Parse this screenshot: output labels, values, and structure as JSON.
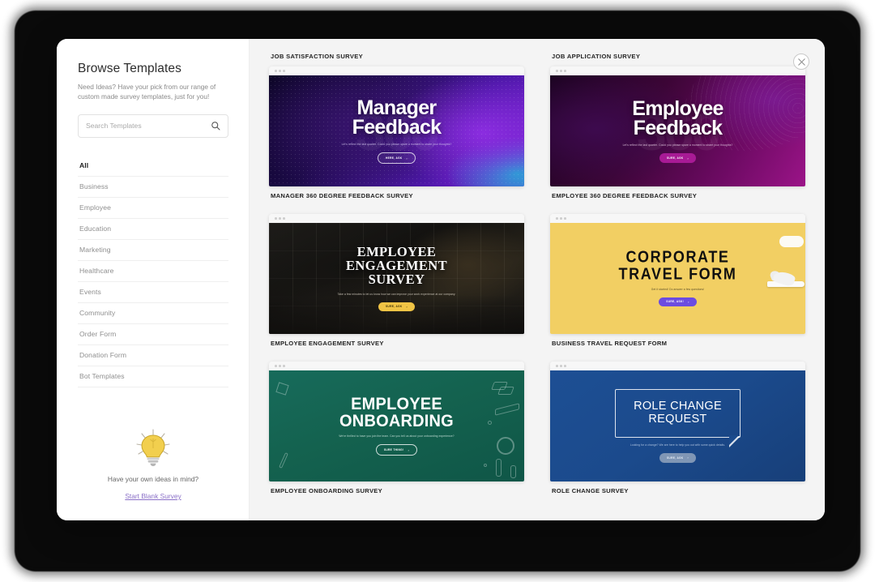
{
  "modal": {
    "close_label": "×",
    "close_icon": "close-circle-icon"
  },
  "sidebar": {
    "title": "Browse Templates",
    "subtitle": "Need Ideas? Have your pick from our range of custom made survey templates, just for you!",
    "search": {
      "placeholder": "Search Templates",
      "value": "",
      "icon": "search-icon"
    },
    "categories": [
      {
        "label": "All",
        "active": true
      },
      {
        "label": "Business",
        "active": false
      },
      {
        "label": "Employee",
        "active": false
      },
      {
        "label": "Education",
        "active": false
      },
      {
        "label": "Marketing",
        "active": false
      },
      {
        "label": "Healthcare",
        "active": false
      },
      {
        "label": "Events",
        "active": false
      },
      {
        "label": "Community",
        "active": false
      },
      {
        "label": "Order Form",
        "active": false
      },
      {
        "label": "Donation Form",
        "active": false
      },
      {
        "label": "Bot Templates",
        "active": false
      }
    ],
    "footer": {
      "icon": "lightbulb-icon",
      "question": "Have your own ideas in mind?",
      "link": "Start Blank Survey"
    }
  },
  "content": {
    "groups": [
      {
        "heading": "JOB SATISFACTION SURVEY"
      },
      {
        "heading": "JOB APPLICATION SURVEY"
      }
    ],
    "templates": [
      {
        "caption": "MANAGER 360 DEGREE FEEDBACK SURVEY",
        "headline_line1": "Manager",
        "headline_line2": "Feedback",
        "watermark": "360",
        "description": "Let's reflect the last quarter. Could you please spare a moment to share your thoughts?",
        "cta": "HERE, ASK",
        "accent": "#7b23d8"
      },
      {
        "caption": "EMPLOYEE 360 DEGREE FEEDBACK SURVEY",
        "headline_line1": "Employee",
        "headline_line2": "Feedback",
        "watermark": "360",
        "description": "Let's reflect the last quarter. Could you please spare a moment to share your thoughts?",
        "cta": "SURE, ASK",
        "accent": "#a81a95"
      },
      {
        "caption": "EMPLOYEE ENGAGEMENT SURVEY",
        "headline_line1": "EMPLOYEE",
        "headline_line2": "ENGAGEMENT",
        "headline_line3": "SURVEY",
        "description": "Take a few minutes to let us know how we can improve your work experience at our company.",
        "cta": "SURE, ASK",
        "accent": "#f0c445"
      },
      {
        "caption": "BUSINESS TRAVEL REQUEST FORM",
        "headline_line1": "CORPORATE",
        "headline_line2": "TRAVEL FORM",
        "description": "Get it started! Do answer a few questions!",
        "cta": "SURE, ASK!",
        "accent": "#6c4ce0"
      },
      {
        "caption": "EMPLOYEE ONBOARDING SURVEY",
        "headline_line1": "EMPLOYEE",
        "headline_line2": "ONBOARDING",
        "description": "We're thrilled to have you join the team. Can you tell us about your onboarding experience?",
        "cta": "SURE THING!",
        "accent": "#ffffff"
      },
      {
        "caption": "ROLE CHANGE SURVEY",
        "headline_line1": "ROLE CHANGE",
        "headline_line2": "REQUEST",
        "description": "Looking for a change? We are here to help you out with some quick details.",
        "cta": "SURE, ASK",
        "accent": "#7f96b5"
      }
    ]
  }
}
